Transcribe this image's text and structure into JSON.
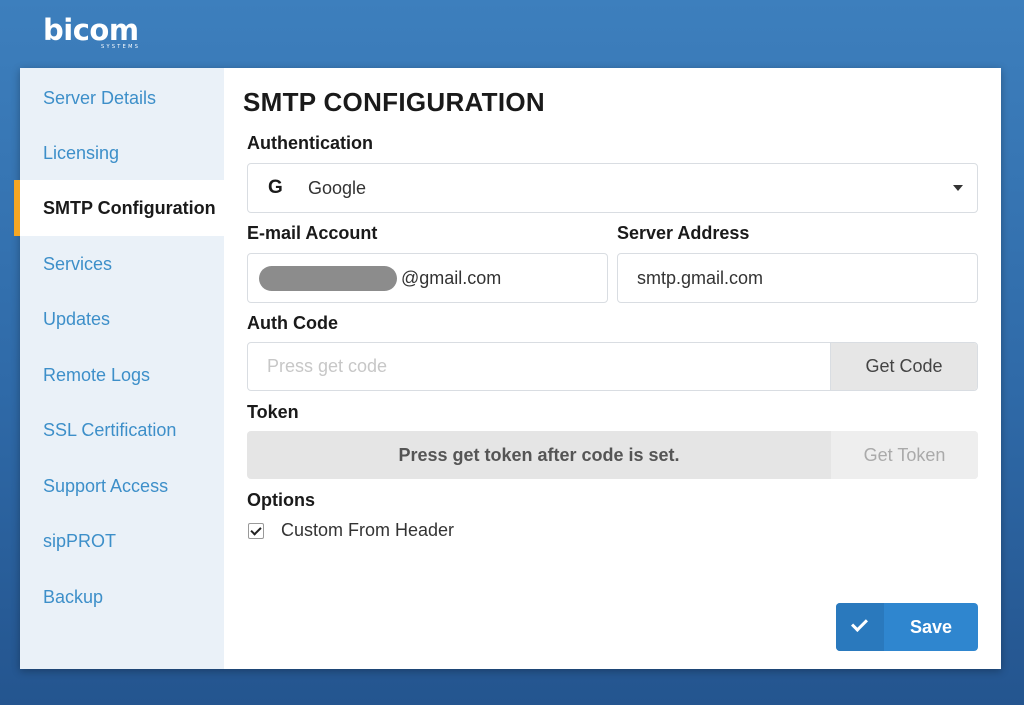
{
  "brand": {
    "name": "bicom",
    "sub": "SYSTEMS"
  },
  "sidebar": {
    "items": [
      {
        "label": "Server Details"
      },
      {
        "label": "Licensing"
      },
      {
        "label": "SMTP Configuration"
      },
      {
        "label": "Services"
      },
      {
        "label": "Updates"
      },
      {
        "label": "Remote Logs"
      },
      {
        "label": "SSL Certification"
      },
      {
        "label": "Support Access"
      },
      {
        "label": "sipPROT"
      },
      {
        "label": "Backup"
      }
    ],
    "active": "SMTP Configuration"
  },
  "main": {
    "title": "SMTP CONFIGURATION",
    "authentication": {
      "label": "Authentication",
      "icon": "G",
      "value": "Google"
    },
    "email": {
      "label": "E-mail Account",
      "suffix": "@gmail.com"
    },
    "server": {
      "label": "Server Address",
      "value": "smtp.gmail.com"
    },
    "auth_code": {
      "label": "Auth Code",
      "placeholder": "Press get code",
      "button": "Get Code"
    },
    "token": {
      "label": "Token",
      "message": "Press get token after code is set.",
      "button": "Get Token"
    },
    "options": {
      "label": "Options",
      "custom_from_header": {
        "label": "Custom From Header",
        "checked": true
      }
    },
    "save_label": "Save"
  },
  "colors": {
    "accent": "#2f86cf",
    "active_marker": "#f5a623",
    "link": "#3d8fc9"
  }
}
